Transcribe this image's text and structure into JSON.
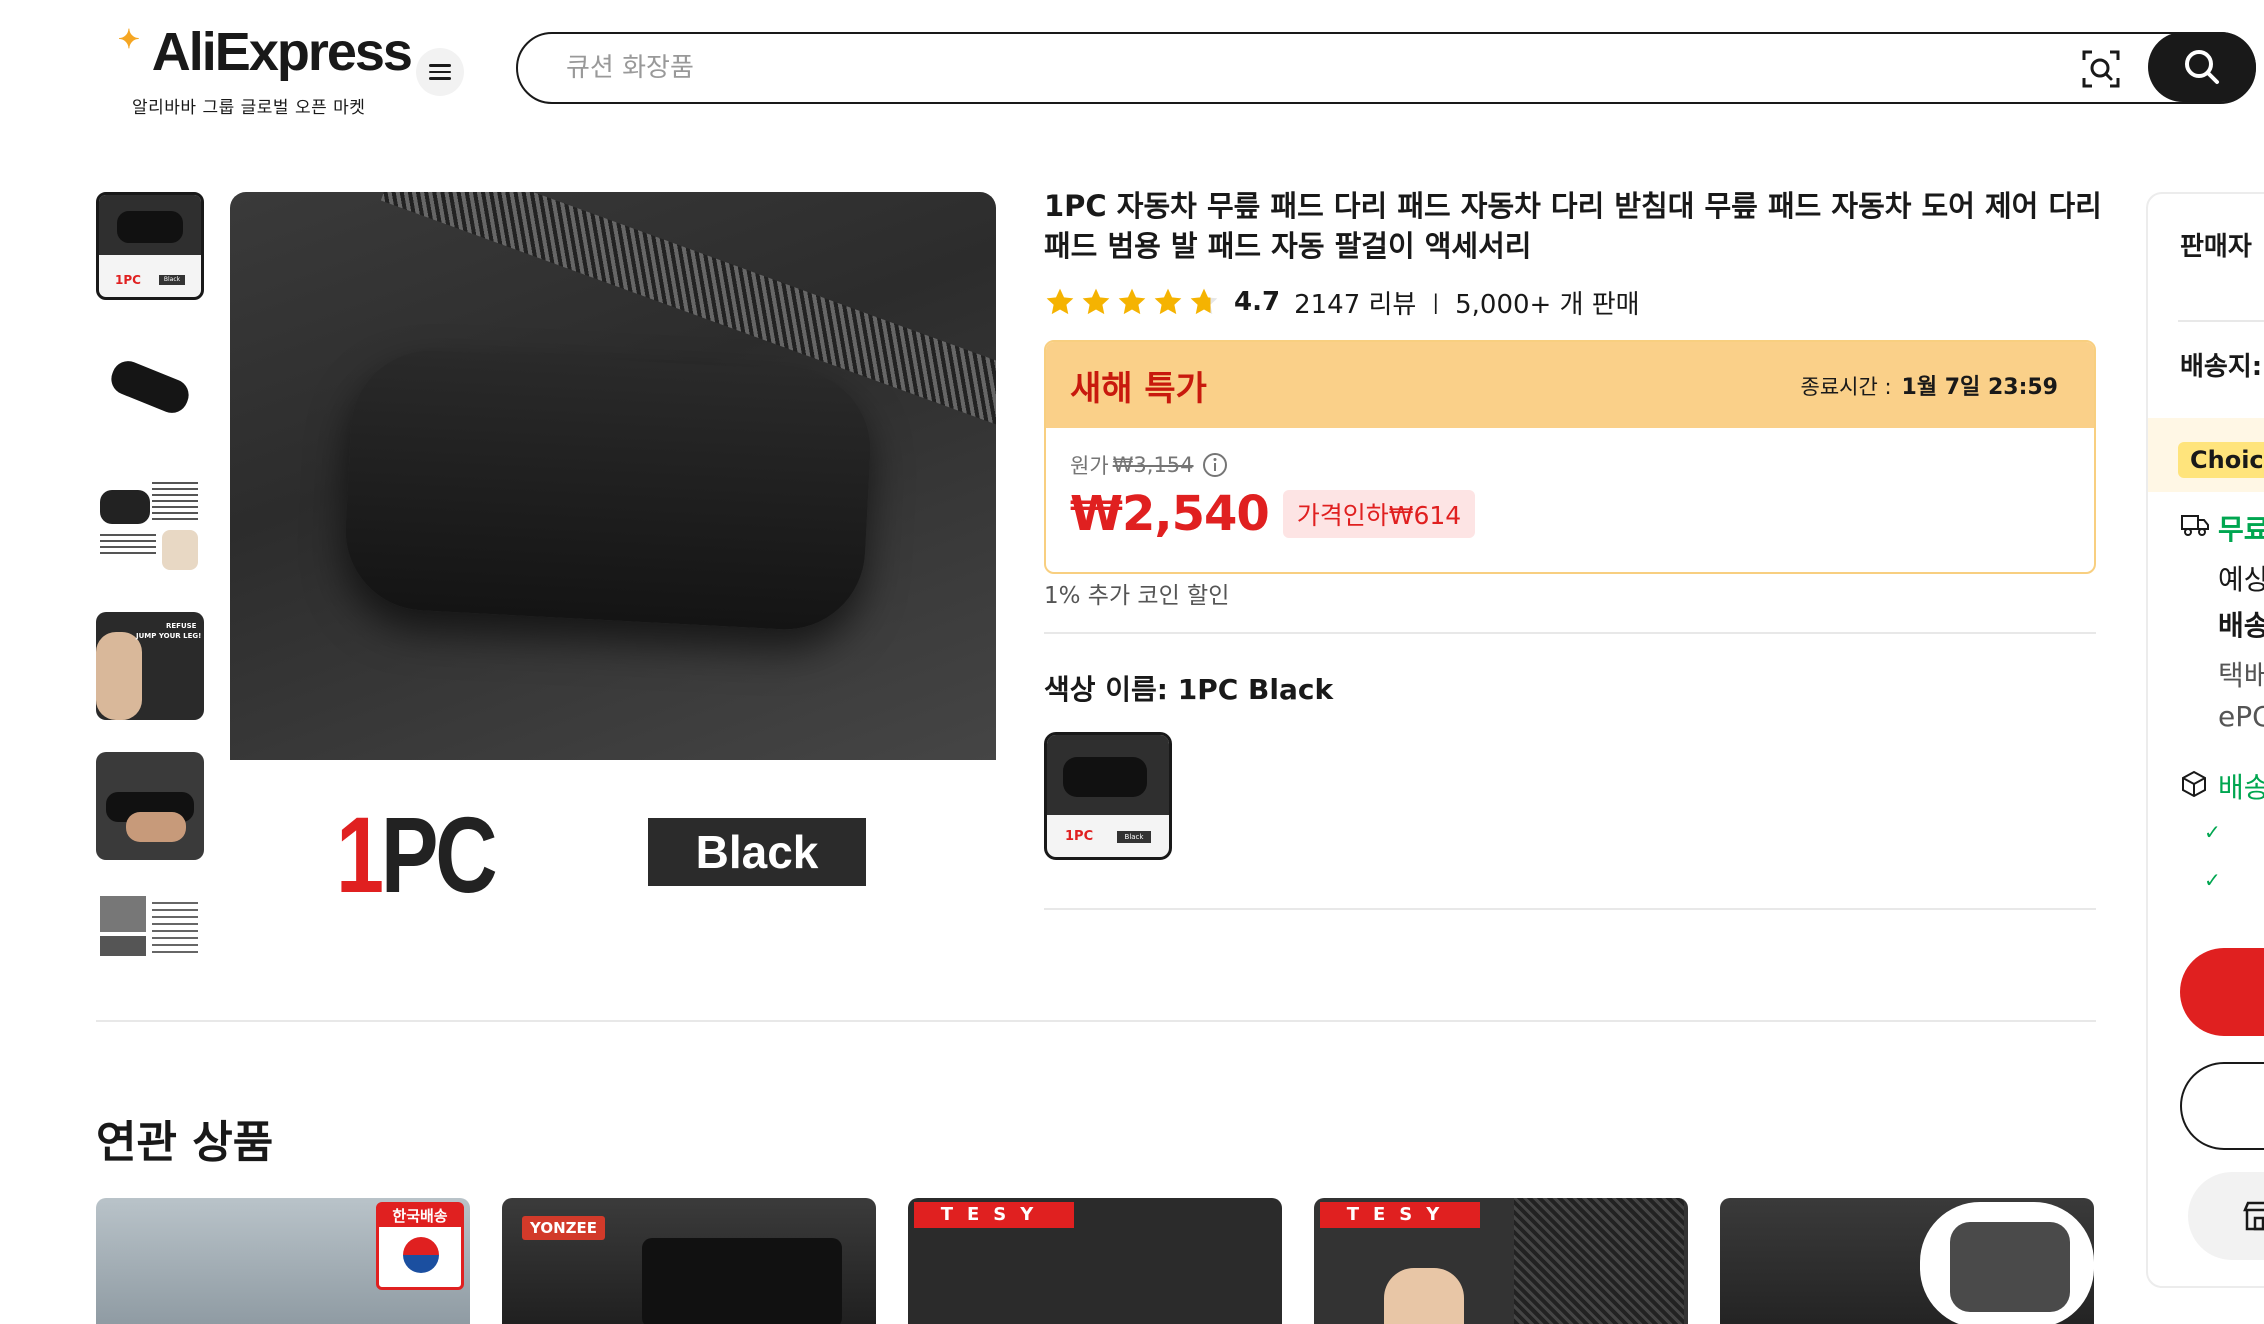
{
  "header": {
    "logo_text": "AliExpress",
    "logo_sub": "알리바바 그룹 글로벌 오픈 마켓",
    "search_placeholder": "큐션 화장품"
  },
  "gallery": {
    "thumbnail_count": 6,
    "main_caption_one": "1",
    "main_caption_pc": "PC",
    "main_badge": "Black",
    "thumb_texts": {
      "t1_pc": "1PC",
      "t1_black": "Black",
      "t4_line1": "REFUSE",
      "t4_line2": "JUMP YOUR LEG!"
    }
  },
  "product": {
    "title": "1PC 자동차 무릎 패드 다리 패드 자동차 다리 받침대 무릎 패드 자동차 도어 제어 다리 패드 범용 발 패드 자동 팔걸이 액세서리",
    "rating": "4.7",
    "reviews": "2147 리뷰",
    "sold": "5,000+ 개 판매",
    "deal": {
      "title": "새해 특가",
      "end_label": "종료시간 :",
      "end_time": "1월 7일 23:59",
      "orig_label": "원가",
      "orig_price": "₩3,154",
      "price": "₩2,540",
      "discount": "가격인하₩614"
    },
    "coin_note": "1% 추가 코인 할인",
    "color_label": "색상 이름: 1PC Black",
    "swatch_pc": "1PC",
    "swatch_black": "Black"
  },
  "related": {
    "title": "연관 상품",
    "cards": [
      {
        "badge": "한국배송"
      },
      {
        "badge": "YONZEE"
      },
      {
        "badge": "TESY"
      },
      {
        "badge": "TESY"
      },
      {
        "badge": ""
      }
    ]
  },
  "right_panel": {
    "seller": "판매자",
    "ship_to": "배송지:",
    "choice": "Choice",
    "free": "무료",
    "line1": "예상",
    "line2": "배송",
    "line3": "택배",
    "line4": "ePC",
    "shipping": "배송"
  },
  "colors": {
    "accent_red": "#e02020",
    "deal_yellow": "#fad089",
    "star": "#f5b301",
    "green": "#00a650"
  }
}
